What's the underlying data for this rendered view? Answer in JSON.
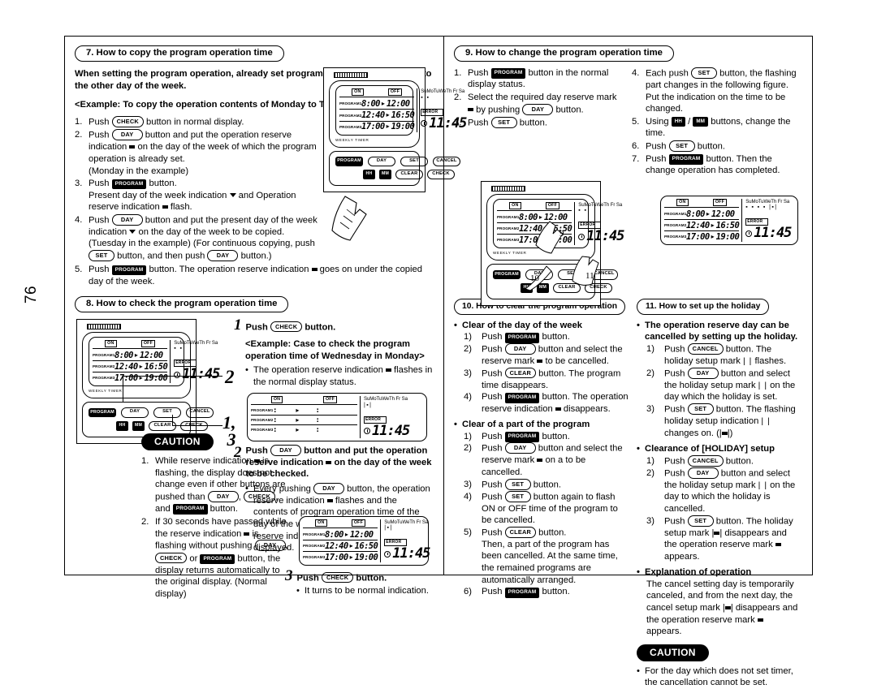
{
  "page": {
    "number": "76"
  },
  "sections": {
    "s7": {
      "title": "7. How to copy the program operation time",
      "intro": "When setting the program operation, already set program can be copied and set to the other day of the week.",
      "example": "<Example: To copy the operation contents of Monday to Tuesday>",
      "steps": [
        {
          "n": "1.",
          "text": "Push ⟦CHECK⟧ button in normal display."
        },
        {
          "n": "2.",
          "text": "Push ⟦DAY⟧ button and put the operation reserve indication ▪ on the day of the week of which the program operation is already set. (Monday in the example)"
        },
        {
          "n": "3.",
          "text": "Push ⟦PROGRAM⟧ button. Present day of the week indication ▼ and Operation reserve indication ▪ flash."
        },
        {
          "n": "4.",
          "text": "Push ⟦DAY⟧ button and put the present day of the week indication ▼ on the day of the week to be copied. (Tuesday in the example) (For continuous copying, push ⟦SET⟧ button, and then push ⟦DAY⟧ button.)"
        },
        {
          "n": "5.",
          "text": "Push ⟦PROGRAM⟧ button. The operation reserve indication ▪ goes on under the copied day of the week."
        }
      ]
    },
    "s8": {
      "title": "8. How to check the program operation time",
      "step1_num": "1",
      "step1_text": "Push ⟦CHECK⟧ button.",
      "step1_example": "<Example: Case to check the program operation time of Wednesday in Monday>",
      "step1_bullet": "The operation reserve indication ▪ flashes in the normal display status.",
      "step2_num": "2",
      "step2_text": "Push ⟦DAY⟧ button and put the operation reserve indication ▪ on the day of the week to be checked.",
      "step2_bullet": "Every pushing ⟦DAY⟧ button, the operation reserve indication ▪ flashes and the contents of program operation time of the day of the week on which the operation reserve indication ▪ has been put on is displayed.",
      "step3_num": "3",
      "step3_text": "Push ⟦CHECK⟧ button.",
      "step3_bullet": "It turns to be normal indication.",
      "callout_2": "2",
      "callout_13": "1, 3",
      "caution_label": "CAUTION",
      "cautions": [
        {
          "n": "1.",
          "text": "While reserve indication ▪ is flashing, the display does not change even if other buttons are pushed than ⟦DAY⟧, ⟦CHECK⟧, and ⟦PROGRAM⟧ button."
        },
        {
          "n": "2.",
          "text": "If 30 seconds have passed while the reserve indication ▪ is flashing without pushing ⟦DAY⟧, ⟦CHECK⟧ or ⟦PROGRAM⟧ button, the display returns automatically to the original display. (Normal display)"
        }
      ]
    },
    "s9": {
      "title": "9. How to change the program operation time",
      "steps_left": [
        {
          "n": "1.",
          "text": "Push ⟦PROGRAM⟧ button in the normal display status."
        },
        {
          "n": "2.",
          "text": "Select the required day reserve mark ▪ by pushing ⟦DAY⟧ button."
        },
        {
          "n": "3.",
          "text": "Push ⟦SET⟧ button."
        }
      ],
      "steps_right": [
        {
          "n": "4.",
          "text": "Each push ⟦SET⟧ button, the flashing part changes in the following figure. Put the indication on the time to be changed."
        },
        {
          "n": "5.",
          "text": "Using ⟦HH⟧ / ⟦MM⟧ buttons, change the time."
        },
        {
          "n": "6.",
          "text": "Push ⟦SET⟧ button."
        },
        {
          "n": "7.",
          "text": "Push ⟦PROGRAM⟧ button. Then the change operation has completed."
        }
      ],
      "callouts": [
        "9",
        "10",
        "11"
      ]
    },
    "s10": {
      "title": "10. How to clear the program operation",
      "group1_title": "Clear of the day of the week",
      "group1": [
        {
          "n": "1)",
          "text": "Push ⟦PROGRAM⟧ button."
        },
        {
          "n": "2)",
          "text": "Push ⟦DAY⟧ button and select the reserve mark ▪ to be cancelled."
        },
        {
          "n": "3)",
          "text": "Push ⟦CLEAR⟧ button. The program time disappears."
        },
        {
          "n": "4)",
          "text": "Push ⟦PROGRAM⟧ button. The operation reserve indication ▪ disappears."
        }
      ],
      "group2_title": "Clear of a part of the program",
      "group2": [
        {
          "n": "1)",
          "text": "Push ⟦PROGRAM⟧ button."
        },
        {
          "n": "2)",
          "text": "Push ⟦DAY⟧ button and select the reserve mark ▪ on a to be cancelled."
        },
        {
          "n": "3)",
          "text": "Push ⟦SET⟧ button."
        },
        {
          "n": "4)",
          "text": "Push ⟦SET⟧ button again to flash ON or OFF time of the program to be cancelled."
        },
        {
          "n": "5)",
          "text": "Push ⟦CLEAR⟧ button. Then, a part of the program has been cancelled. At the same time, the remained programs are automatically arranged."
        },
        {
          "n": "6)",
          "text": "Push ⟦PROGRAM⟧ button."
        }
      ]
    },
    "s11": {
      "title": "11. How to set up the holiday",
      "group1_title": "The operation reserve day can be cancelled by setting up the holiday.",
      "group1": [
        {
          "n": "1)",
          "text": "Push ⟦CANCEL⟧ button. The holiday setup mark | | flashes."
        },
        {
          "n": "2)",
          "text": "Push ⟦DAY⟧ button and select the holiday setup mark | | on the day which the holiday is set."
        },
        {
          "n": "3)",
          "text": "Push ⟦SET⟧ button. The flashing holiday setup indication | | changes on. (|▪|)"
        }
      ],
      "group2_title": "Clearance of [HOLIDAY] setup",
      "group2": [
        {
          "n": "1)",
          "text": "Push ⟦CANCEL⟧ button."
        },
        {
          "n": "2)",
          "text": "Push ⟦DAY⟧ button and select the holiday setup mark | | on the day to which the holiday is cancelled."
        },
        {
          "n": "3)",
          "text": "Push ⟦SET⟧ button. The holiday setup mark |▪| disappears and the operation reserve mark ▪ appears."
        }
      ],
      "group3_title": "Explanation of operation",
      "group3_text": "The cancel setting day is temporarily canceled, and from the next day, the cancel setup mark |▪| disappears and the operation reserve mark ▪ appears.",
      "caution_label": "CAUTION",
      "caution_text": "For the day which does not set timer, the cancellation cannot be set."
    }
  },
  "lcd": {
    "on_label": "ON",
    "off_label": "OFF",
    "program_labels": [
      "PROGRAM1",
      "PROGRAM2",
      "PROGRAM3"
    ],
    "program_times": [
      {
        "on": "8:00",
        "off": "12:00"
      },
      {
        "on": "12:40",
        "off": "16:50"
      },
      {
        "on": "17:00",
        "off": "19:00"
      }
    ],
    "blank_times": [
      {
        "on": ":",
        "off": ":"
      },
      {
        "on": ":",
        "off": ":"
      },
      {
        "on": ":",
        "off": ":"
      }
    ],
    "days": "SuMoTuWeTh Fr Sa",
    "error_label": "ERROR",
    "clock": "11:45",
    "weekly_timer_label": "WEEKLY TIMER"
  },
  "keypad": {
    "row1": [
      "PROGRAM",
      "DAY",
      "SET",
      "CANCEL"
    ],
    "row2": [
      "HH",
      "MM",
      "CLEAR",
      "CHECK"
    ]
  }
}
